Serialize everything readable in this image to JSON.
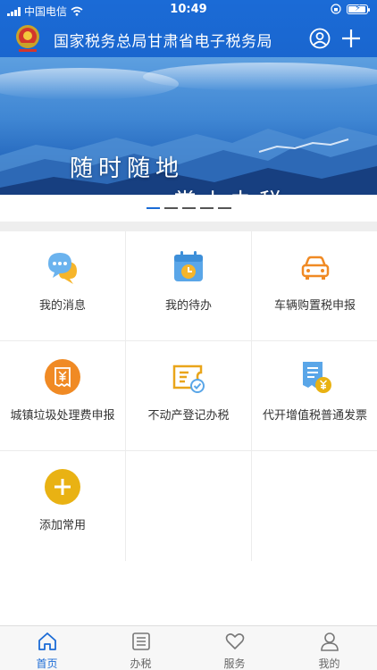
{
  "status_bar": {
    "carrier": "中国电信",
    "time": "10:49"
  },
  "header": {
    "title": "国家税务总局甘肃省电子税务局",
    "user_icon": "user-circle-icon",
    "add_icon": "plus-icon"
  },
  "banner": {
    "line1": "随时随地",
    "line2": "掌上办税",
    "slide_count": 5,
    "active_slide": 1
  },
  "grid": {
    "items": [
      {
        "label": "我的消息",
        "icon": "chat-bubble-icon"
      },
      {
        "label": "我的待办",
        "icon": "calendar-clock-icon"
      },
      {
        "label": "车辆购置税申报",
        "icon": "car-icon"
      },
      {
        "label": "城镇垃圾处理费申报",
        "icon": "yuan-receipt-icon"
      },
      {
        "label": "不动产登记办税",
        "icon": "ticket-check-icon"
      },
      {
        "label": "代开增值税普通发票",
        "icon": "invoice-yuan-icon"
      },
      {
        "label": "添加常用",
        "icon": "add-circle-icon"
      }
    ]
  },
  "tabs": [
    {
      "label": "首页",
      "icon": "home-icon",
      "active": true
    },
    {
      "label": "办税",
      "icon": "list-icon",
      "active": false
    },
    {
      "label": "服务",
      "icon": "heart-icon",
      "active": false
    },
    {
      "label": "我的",
      "icon": "person-icon",
      "active": false
    }
  ],
  "colors": {
    "primary": "#1b6bd6",
    "orange": "#f08a24",
    "gold": "#e9b213",
    "light_blue": "#5aa6e8"
  }
}
